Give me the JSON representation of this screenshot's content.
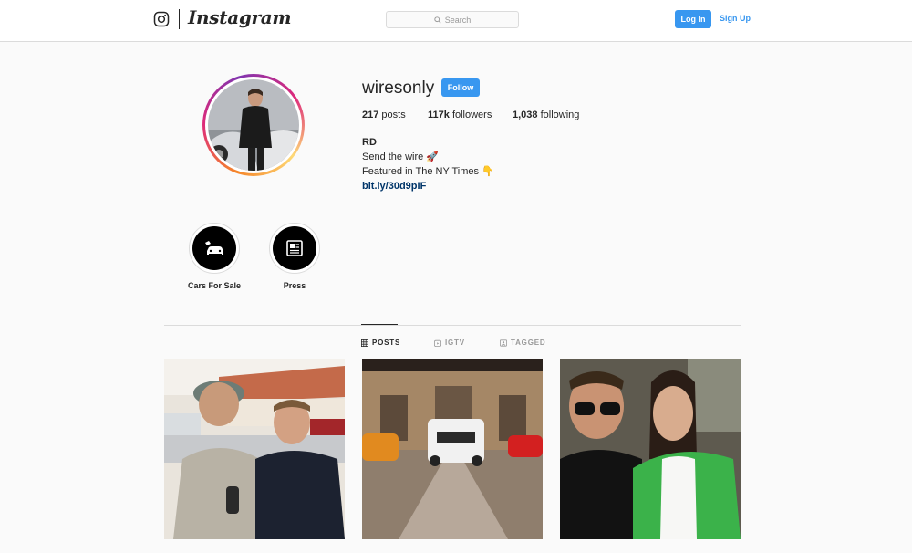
{
  "nav": {
    "wordmark": "Instagram",
    "search_placeholder": "Search",
    "login_label": "Log In",
    "signup_label": "Sign Up",
    "accent": "#3897f0"
  },
  "profile": {
    "username": "wiresonly",
    "follow_label": "Follow",
    "stats": {
      "posts_count": "217",
      "posts_label": "posts",
      "followers_count": "117k",
      "followers_label": "followers",
      "following_count": "1,038",
      "following_label": "following"
    },
    "bio": {
      "full_name": "RD",
      "line1": "Send the wire 🚀",
      "line2": "Featured in The NY Times 👇",
      "link": "bit.ly/30d9pIF"
    }
  },
  "highlights": [
    {
      "label": "Cars For Sale",
      "icon": "car-tag-icon"
    },
    {
      "label": "Press",
      "icon": "newspaper-icon"
    }
  ],
  "tabs": [
    {
      "label": "POSTS",
      "icon": "grid-icon",
      "active": true
    },
    {
      "label": "IGTV",
      "icon": "igtv-icon",
      "active": false
    },
    {
      "label": "TAGGED",
      "icon": "tagged-icon",
      "active": false
    }
  ],
  "posts": [
    {
      "description": "two men posing outdoors"
    },
    {
      "description": "cars parked in villa courtyard"
    },
    {
      "description": "man and woman selfie"
    }
  ]
}
